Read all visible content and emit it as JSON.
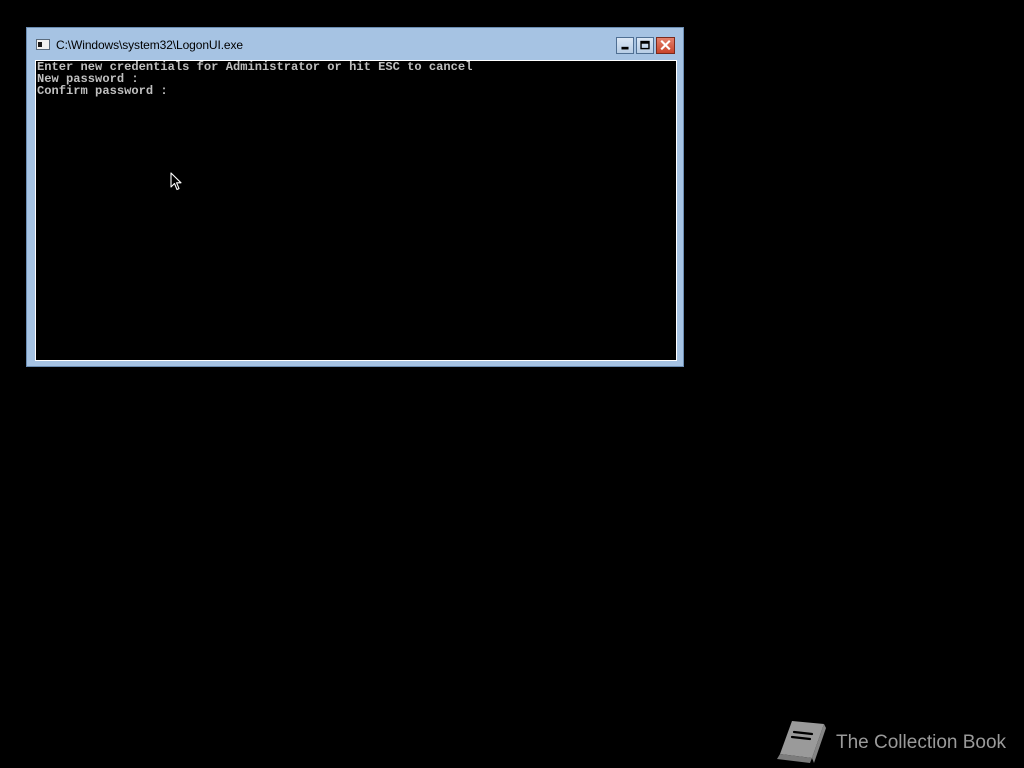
{
  "window": {
    "title": "C:\\Windows\\system32\\LogonUI.exe",
    "controls": {
      "minimize_icon": "minimize-icon",
      "maximize_icon": "maximize-icon",
      "close_icon": "close-icon"
    }
  },
  "console": {
    "lines": [
      "Enter new credentials for Administrator or hit ESC to cancel",
      "New password :",
      "Confirm password :"
    ],
    "text_color": "#c0c0c0",
    "background": "#000000"
  },
  "colors": {
    "window_frame": "#a6c3e3",
    "close_button": "#c9452c",
    "desktop": "#000000"
  },
  "watermark": {
    "icon": "book-icon",
    "text": "The Collection Book"
  }
}
